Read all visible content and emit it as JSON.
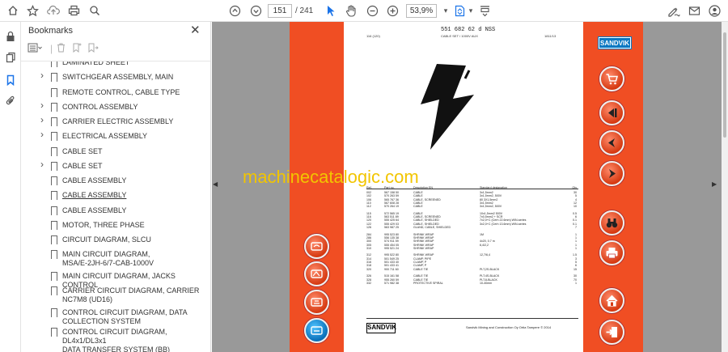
{
  "toolbar": {
    "page_current": "151",
    "page_total": "/ 241",
    "zoom": "53,9%",
    "icons": [
      "home-icon",
      "star-icon",
      "upload-icon",
      "print-icon",
      "search-icon",
      "page-up-icon",
      "page-down-icon",
      "cursor-icon",
      "hand-icon",
      "zoom-out-icon",
      "zoom-in-icon",
      "fit-page-icon",
      "scroll-icon",
      "sign-icon",
      "mail-icon",
      "account-icon"
    ]
  },
  "left_rail": {
    "icons": [
      "lock-icon",
      "copy-icon",
      "bookmark-icon",
      "paperclip-icon"
    ]
  },
  "bookmarks": {
    "title": "Bookmarks",
    "items": [
      {
        "label": "LAMINATED SHEET",
        "expandable": false
      },
      {
        "label": "SWITCHGEAR ASSEMBLY, MAIN",
        "expandable": true
      },
      {
        "label": "REMOTE CONTROL, CABLE TYPE",
        "expandable": false
      },
      {
        "label": "CONTROL ASSEMBLY",
        "expandable": true
      },
      {
        "label": "CARRIER ELECTRIC ASSEMBLY",
        "expandable": true
      },
      {
        "label": "ELECTRICAL ASSEMBLY",
        "expandable": true
      },
      {
        "label": "CABLE SET",
        "expandable": false
      },
      {
        "label": "CABLE SET",
        "expandable": true
      },
      {
        "label": "CABLE ASSEMBLY",
        "expandable": false
      },
      {
        "label": "CABLE ASSEMBLY",
        "expandable": false,
        "selected": true
      },
      {
        "label": "CABLE ASSEMBLY",
        "expandable": false
      },
      {
        "label": "MOTOR, THREE PHASE",
        "expandable": false
      },
      {
        "label": "CIRCUIT DIAGRAM, SLCU",
        "expandable": false
      },
      {
        "label": "MAIN CIRCUIT DIAGRAM,\nMSA/E-2JH-6/7-CAB-1000V",
        "expandable": false
      },
      {
        "label": "MAIN CIRCUIT DIAGRAM, JACKS CONTROL",
        "expandable": false
      },
      {
        "label": "CARRIER CIRCUIT DIAGRAM, CARRIER\nNC7M8 (UD16)",
        "expandable": false
      },
      {
        "label": "CONTROL CIRCUIT DIAGRAM, DATA\nCOLLECTION SYSTEM",
        "expandable": false
      },
      {
        "label": "CONTROL CIRCUIT DIAGRAM, DL4x1/DL3x1\nDATA TRANSFER SYSTEM (BB)",
        "expandable": false
      }
    ]
  },
  "document": {
    "brand": "SANDVIK",
    "header_code": "551 682 62 d NSS",
    "header_left": "116 (120)",
    "header_mid": "CABLE SET / 1000V AUX",
    "header_right": "1811/13",
    "table_headers": [
      "Ref.",
      "Part no.",
      "Description EN",
      "Standard designation",
      "Qty"
    ],
    "rows": [
      [
        "002",
        "567 158 50",
        "CABLE",
        "3x1,5mm2",
        "30"
      ],
      [
        "102",
        "570 263 59",
        "CABLE",
        "3x1,5mm2, 500V",
        "5"
      ],
      [
        "106",
        "565 767 36",
        "CABLE, SCREENED",
        "80 3X1,5mm2",
        "4"
      ],
      [
        "110",
        "567 608 28",
        "CABLE",
        "3x1,5mm2",
        "12"
      ],
      [
        "112",
        "570 264 19",
        "CABLE",
        "3x1,5mm2, 500V",
        "10"
      ],
      [
        "",
        "",
        "",
        "",
        ""
      ],
      [
        "115",
        "572 565 19",
        "CABLE",
        "10x1,5mm2 500V",
        "0.5"
      ],
      [
        "116",
        "563 511 89",
        "CABLE, SCREENED",
        "7x0,5mm2 + SCR",
        "6"
      ],
      [
        "120",
        "555 425 64",
        "CABLE, SHIELDED",
        "7x2,0+C (Cerh 22.6mm) WIN-series",
        "0.1"
      ],
      [
        "122",
        "555 429 03",
        "CABLE, SHIELDED",
        "3x2,0+C (Cerh 13.6mm) WIN-series",
        "0.1"
      ],
      [
        "126",
        "563 987 25",
        "GLAND, CABLE, SHIELDED",
        "",
        "7"
      ],
      [
        "",
        "",
        "",
        "",
        ""
      ],
      [
        "284",
        "995 523 80",
        "SHRINK WRAP",
        "1M",
        "1"
      ],
      [
        "286",
        "556 135 38",
        "SHRINK WRAP",
        "",
        "1"
      ],
      [
        "300",
        "574 911 59",
        "SHRINK WRAP",
        "4x20, 0.7 m",
        "1"
      ],
      [
        "305",
        "555 454 05",
        "SHRINK WRAP",
        "6,4/2,2",
        "1"
      ],
      [
        "310",
        "995 521 24",
        "SHRINK WRAP",
        "",
        "1"
      ],
      [
        "",
        "",
        "",
        "",
        ""
      ],
      [
        "312",
        "995 522 80",
        "SHRINK WRAP",
        "12,7/6,4",
        "1.5"
      ],
      [
        "314",
        "501 549 25",
        "CLAMP, PIPE",
        "",
        "3"
      ],
      [
        "316",
        "501 433 40",
        "CLAMP, P",
        "",
        "5"
      ],
      [
        "318",
        "501 433 41",
        "CLAMP, P",
        "",
        "6"
      ],
      [
        "320",
        "900 711 60",
        "CABLE TIE",
        "PLT,2S-BLACK",
        "15"
      ],
      [
        "",
        "",
        "",
        "",
        ""
      ],
      [
        "326",
        "515 161 58",
        "CABLE TIE",
        "PLT.4S-BLACK",
        "30"
      ],
      [
        "328",
        "955 260 59",
        "CABLE TIE",
        "PLT.8-BLACK",
        "70"
      ],
      [
        "332",
        "571 982 38",
        "PROTECTIVE SPIRAL",
        "10-40mm",
        "1"
      ]
    ],
    "footer_text": "Sandvik Mining and Construction Oy Ortia Tampere © 2014"
  },
  "watermark": "machinecatalogic.com",
  "colors": {
    "accent": "#f04e23",
    "canvas": "#999999",
    "brand_blue": "#0a78c2"
  }
}
